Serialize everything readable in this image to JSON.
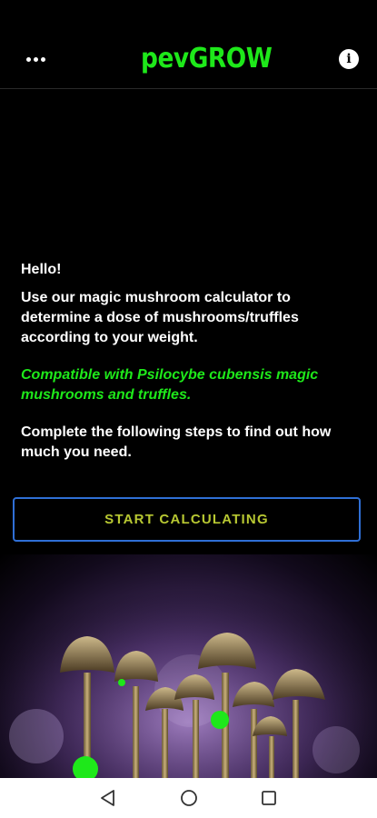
{
  "header": {
    "logo_text": "pevGROW",
    "menu_icon": "more-dots-icon",
    "info_icon": "info-icon"
  },
  "main": {
    "greeting": "Hello!",
    "intro": "Use our magic mushroom calculator to determine a dose of mushrooms/truffles according to your weight.",
    "compatibility": "Compatible with Psilocybe cubensis magic mushrooms and truffles.",
    "instructions": "Complete the following steps to find out how much you need.",
    "start_button": "START CALCULATING"
  },
  "nav": {
    "back_icon": "back-triangle-icon",
    "home_icon": "home-circle-icon",
    "recents_icon": "recents-square-icon"
  },
  "colors": {
    "accent_green": "#1ee81a",
    "button_border": "#2f6fd6",
    "button_text": "#b8c832",
    "background": "#000000"
  }
}
